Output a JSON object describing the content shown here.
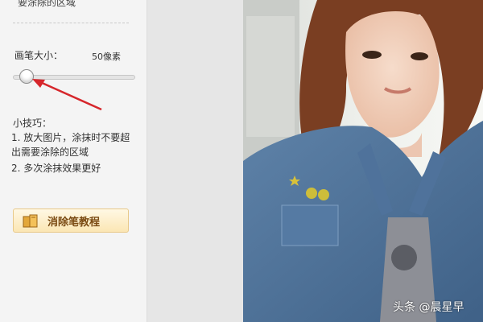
{
  "sidebar": {
    "top_text": "要涂除的区域",
    "brush_size": {
      "label": "画笔大小：",
      "value_text": "50像素",
      "level_fraction": 0.1
    },
    "tips": {
      "title": "小技巧：",
      "items": [
        "1. 放大图片，涂抹时不要超出需要涂除的区域",
        "2. 多次涂抹效果更好"
      ]
    },
    "tutorial_button": {
      "label": "消除笔教程",
      "icon": "book-icon"
    }
  },
  "watermark": {
    "text": "头条 @晨星早"
  },
  "colors": {
    "sidebar_bg": "#f4f4f4",
    "button_gradient_top": "#fff8e4",
    "button_gradient_bottom": "#fbe6b4",
    "button_text": "#7a4a12",
    "arrow": "#d6262b",
    "denim": "#4a6e96"
  }
}
